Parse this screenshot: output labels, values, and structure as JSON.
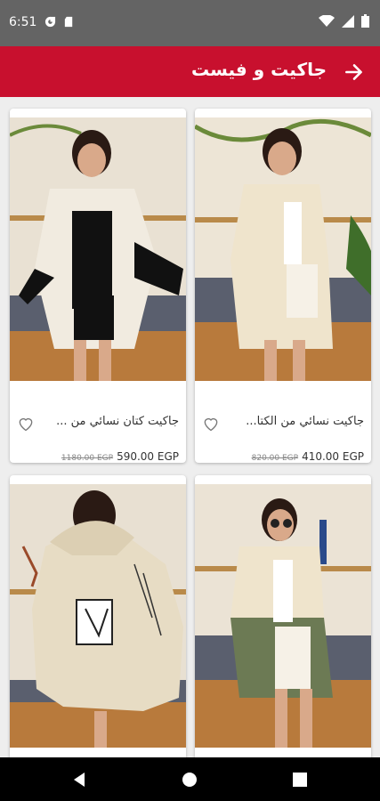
{
  "status_bar": {
    "time": "6:51",
    "left_icons": [
      "data-saver-icon",
      "sd-card-icon"
    ],
    "right_icons": [
      "wifi-icon",
      "signal-icon",
      "battery-icon"
    ]
  },
  "app_bar": {
    "title": "جاكيت و فيست",
    "back_icon": "arrow-right-icon",
    "background_color": "#c8102e"
  },
  "products": [
    {
      "title": "جاكيت كتان نسائي من ...",
      "price": "590.00 EGP",
      "old_price": "1180.00 EGP",
      "image_icon": "woman-white-black-jacket-photo"
    },
    {
      "title": "جاكيت نسائي من الكتا...",
      "price": "410.00 EGP",
      "old_price": "820.00 EGP",
      "image_icon": "woman-cream-jacket-photo"
    },
    {
      "title": "",
      "price": "",
      "old_price": "",
      "image_icon": "woman-printed-hooded-jacket-photo"
    },
    {
      "title": "",
      "price": "",
      "old_price": "",
      "image_icon": "woman-cream-olive-jacket-photo"
    }
  ],
  "nav_bar": {
    "back_icon": "nav-back-icon",
    "home_icon": "nav-home-icon",
    "recents_icon": "nav-recents-icon"
  }
}
